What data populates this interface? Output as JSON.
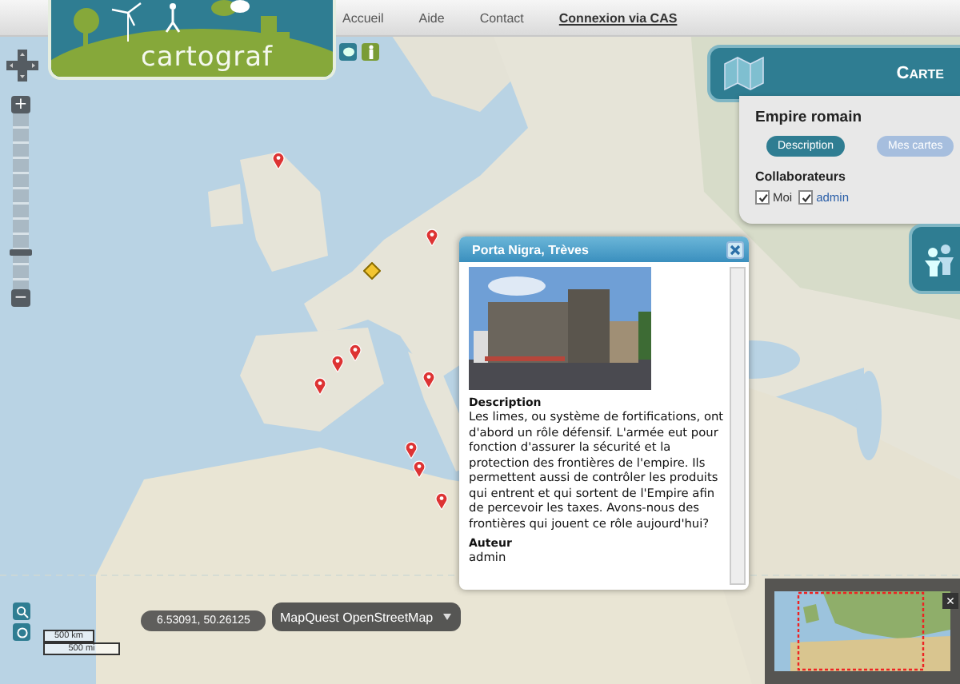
{
  "logo": {
    "text": "cartograf"
  },
  "nav": [
    {
      "label": "Accueil",
      "kind": "link"
    },
    {
      "label": "Aide",
      "kind": "link"
    },
    {
      "label": "Contact",
      "kind": "link"
    },
    {
      "label": "Connexion via CAS",
      "kind": "login"
    }
  ],
  "zoom": {
    "plus": "+",
    "minus": "−",
    "level": 0.2
  },
  "panel": {
    "title": "Carte",
    "map_name": "Empire romain",
    "buttons": [
      {
        "label": "Description",
        "selected": true
      },
      {
        "label": "Mes cartes",
        "selected": false
      }
    ],
    "collaborators_heading": "Collaborateurs",
    "collaborators": [
      {
        "name": "Moi",
        "checked": true,
        "kind": "plain"
      },
      {
        "name": "admin",
        "checked": true,
        "kind": "link"
      }
    ]
  },
  "popup": {
    "title": "Porta Nigra, Trèves",
    "sections": [
      {
        "heading": "Description",
        "text": "Les limes, ou système de fortifications, ont d'abord un rôle défensif. L'armée eut pour fonction d'assurer la sécurité et la protection des frontières de l'empire. Ils permettent aussi de contrôler les produits qui entrent et qui sortent de l'Empire afin de percevoir les taxes. Avons-nous des frontières qui jouent ce rôle aujourd'hui?"
      },
      {
        "heading": "Auteur",
        "text": "admin"
      }
    ]
  },
  "coordinates": "6.53091, 50.26125",
  "scale": {
    "km": "500 km",
    "mi": "500 mi"
  },
  "layer_switcher": {
    "label": "MapQuest OpenStreetMap"
  },
  "overview": {
    "close": "×"
  }
}
